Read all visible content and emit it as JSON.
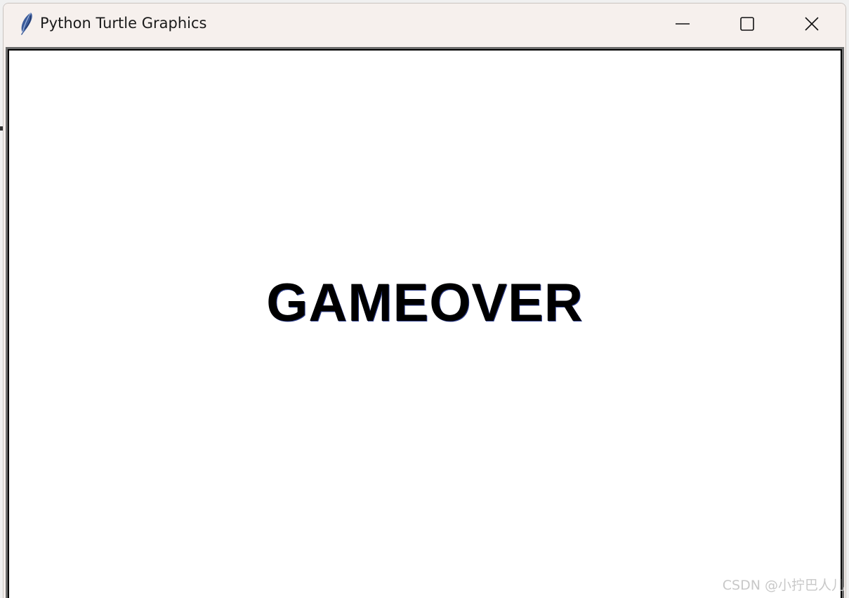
{
  "window": {
    "title": "Python Turtle Graphics",
    "icon": "feather-icon"
  },
  "controls": {
    "minimize": "minimize-icon",
    "maximize": "maximize-icon",
    "close": "close-icon"
  },
  "canvas": {
    "message": "GAMEOVER"
  },
  "watermark": {
    "text": "CSDN @小拧巴人儿"
  },
  "colors": {
    "titlebar": "#f6f0ed",
    "canvas_bg": "#ffffff",
    "text": "#000000",
    "frame": "#6b6b6b"
  }
}
